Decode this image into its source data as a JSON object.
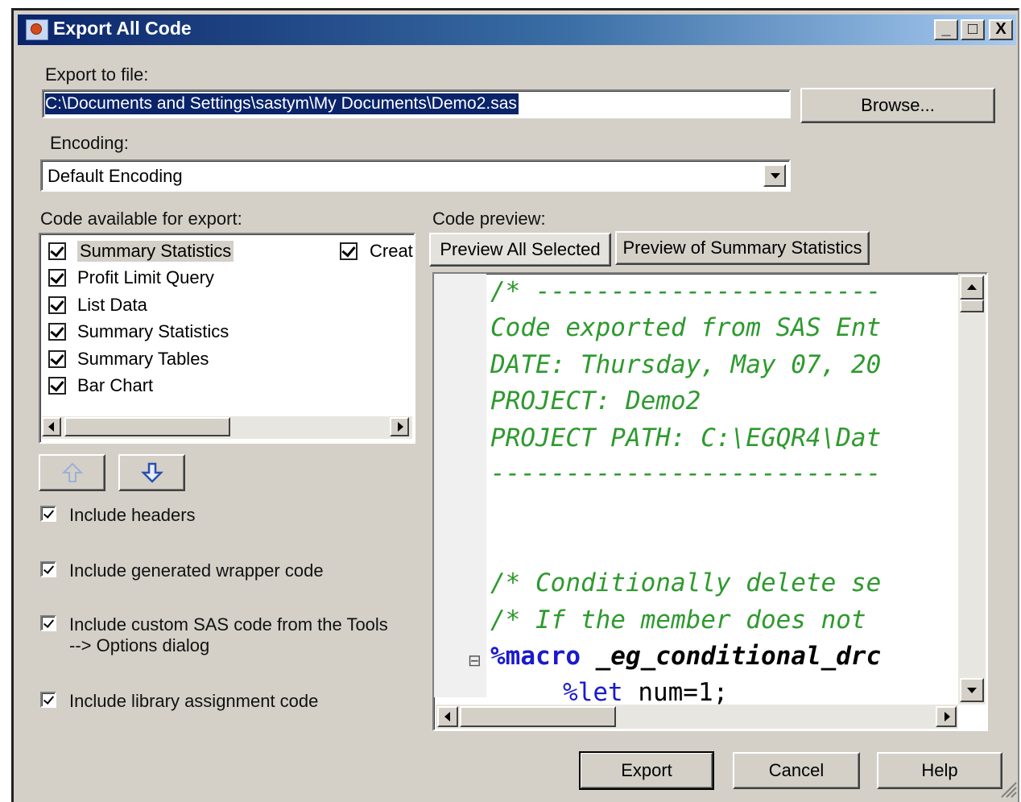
{
  "dialog": {
    "title": "Export All Code",
    "caption_buttons": {
      "minimize": "_",
      "maximize": "□",
      "close": "X"
    }
  },
  "export_file": {
    "label": "Export to file:",
    "value": "C:\\Documents and Settings\\sastym\\My Documents\\Demo2.sas",
    "browse_label": "Browse..."
  },
  "encoding": {
    "label": "Encoding:",
    "selected": "Default Encoding"
  },
  "code_list": {
    "label": "Code available for export:",
    "items": [
      {
        "label": "Summary Statistics",
        "checked": true,
        "selected": true
      },
      {
        "label": "Profit Limit Query",
        "checked": true
      },
      {
        "label": "List Data",
        "checked": true
      },
      {
        "label": "Summary Statistics",
        "checked": true
      },
      {
        "label": "Summary Tables",
        "checked": true
      },
      {
        "label": "Bar Chart",
        "checked": true
      }
    ],
    "second_column": {
      "label": "Creat",
      "checked": true
    }
  },
  "options": {
    "include_headers": {
      "label": "Include headers",
      "checked": true
    },
    "include_wrapper": {
      "label": "Include generated wrapper code",
      "checked": true
    },
    "include_custom_line1": "Include custom SAS code from the Tools",
    "include_custom_line2": "--> Options dialog",
    "include_library": {
      "label": "Include library assignment code",
      "checked": true
    }
  },
  "preview": {
    "label": "Code preview:",
    "tab_all": "Preview All Selected",
    "tab_summary": "Preview of Summary Statistics",
    "lines": {
      "l1": "/* -----------------------",
      "l2": "Code exported from SAS Ent",
      "l3": "DATE: Thursday, May 07, 20",
      "l4": "PROJECT: Demo2",
      "l5": "PROJECT PATH: C:\\EGQR4\\Dat",
      "l6": "--------------------------",
      "l7": "/* Conditionally delete se",
      "l8": "/* If the member does not ",
      "l9_kw": "%macro",
      "l9_name": " _eg_conditional_drc",
      "l10_kw": "%let",
      "l10_rest": " num=1;"
    },
    "fold_marker": "⊟"
  },
  "buttons": {
    "export": "Export",
    "cancel": "Cancel",
    "help": "Help"
  },
  "colors": {
    "comment": "#2e9a2e",
    "keyword": "#1a1acc",
    "dialog_bg": "#d4d0c8"
  }
}
